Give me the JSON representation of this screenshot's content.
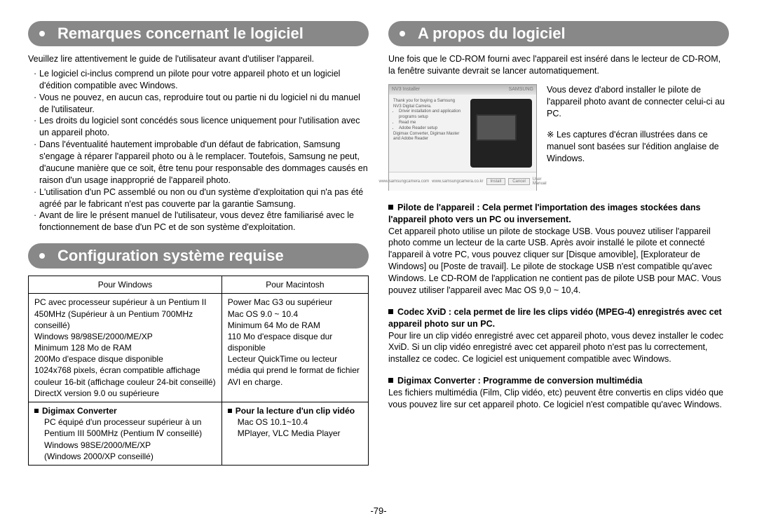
{
  "page_number": "-79-",
  "left": {
    "heading1": "Remarques concernant le logiciel",
    "intro": "Veuillez lire attentivement le guide de l'utilisateur avant d'utiliser l'appareil.",
    "bullets": [
      "Le logiciel ci-inclus comprend un pilote pour votre appareil photo et un logiciel d'édition compatible avec Windows.",
      "Vous ne pouvez, en aucun cas, reproduire tout ou partie ni du logiciel ni du manuel de l'utilisateur.",
      "Les droits du logiciel sont concédés sous licence uniquement pour l'utilisation avec un appareil photo.",
      "Dans l'éventualité hautement improbable d'un défaut de fabrication, Samsung s'engage à réparer l'appareil photo ou à le remplacer. Toutefois, Samsung ne peut, d'aucune manière que ce soit, être tenu pour responsable des dommages causés en raison d'un usage inapproprié de l'appareil photo.",
      "L'utilisation d'un PC assemblé ou non ou d'un système d'exploitation qui n'a pas été agréé par le fabricant n'est pas couverte par la garantie Samsung.",
      "Avant de lire le présent manuel de l'utilisateur, vous devez être familiarisé avec le fonctionnement de base d'un PC et de son système d'exploitation."
    ],
    "heading2": "Configuration système requise",
    "table": {
      "win_header": "Pour Windows",
      "mac_header": "Pour Macintosh",
      "win_body": [
        "PC avec processeur supérieur à un Pentium II 450MHz (Supérieur à un Pentium 700MHz conseillé)",
        "Windows 98/98SE/2000/ME/XP",
        "Minimum 128 Mo de RAM",
        "200Mo d'espace disque disponible",
        "1024x768 pixels, écran compatible affichage couleur 16-bit (affichage couleur 24-bit conseillé)",
        "DirectX version 9.0 ou supérieure"
      ],
      "mac_body": [
        "Power Mac G3 ou supérieur",
        "Mac OS 9.0 ~ 10.4",
        "Minimum 64 Mo de RAM",
        "110 Mo d'espace disque dur disponible",
        "Lecteur QuickTime ou lecteur média qui prend le format de fichier AVI en charge."
      ],
      "win_sub_title": "Digimax Converter",
      "win_sub_body": [
        "PC équipé d'un processeur supérieur à un Pentium III 500MHz (Pentium Ⅳ conseillé)",
        "Windows 98SE/2000/ME/XP",
        "(Windows 2000/XP conseillé)"
      ],
      "mac_sub_title": "Pour la lecture d'un clip vidéo",
      "mac_sub_body": [
        "Mac OS 10.1~10.4",
        "MPlayer, VLC Media Player"
      ]
    }
  },
  "right": {
    "heading": "A propos du logiciel",
    "intro": "Une fois que le CD-ROM fourni avec l'appareil est inséré dans le lecteur de CD-ROM, la fenêtre suivante devrait se lancer automatiquement.",
    "screenshot": {
      "installer_title": "NV3 Installer",
      "brand": "SAMSUNG",
      "install_btn": "Install",
      "cancel_btn": "Cancel",
      "link1": "www.samsungcamera.com",
      "link2": "www.samsungcamera.co.kr",
      "link3": "User Manual"
    },
    "side_text": "Vous devez d'abord installer le pilote de l'appareil photo avant de connecter celui-ci au PC.",
    "side_note": "Les captures d'écran illustrées dans ce manuel sont basées sur l'édition anglaise de Windows.",
    "sections": [
      {
        "title": "Pilote de l'appareil : Cela permet l'importation des images stockées dans l'appareil photo vers un PC ou inversement.",
        "body": "Cet appareil photo utilise un pilote de stockage USB. Vous pouvez utiliser l'appareil photo comme un lecteur de la carte USB. Après avoir installé le pilote et connecté l'appareil à votre PC, vous pouvez cliquer sur [Disque amovible], [Explorateur de Windows] ou [Poste de travail]. Le pilote de stockage USB n'est compatible qu'avec Windows. Le CD-ROM de l'application ne contient pas de pilote USB pour MAC. Vous pouvez utiliser l'appareil avec Mac OS 9,0 ~ 10,4."
      },
      {
        "title": "Codec XviD : cela permet de lire les clips vidéo (MPEG-4) enregistrés avec cet appareil photo sur un PC.",
        "body": "Pour lire un clip vidéo enregistré avec cet appareil photo, vous devez installer le codec XviD. Si un clip vidéo enregistré avec cet appareil photo n'est pas lu correctement, installez ce codec. Ce logiciel est uniquement compatible avec Windows."
      },
      {
        "title": "Digimax Converter : Programme de conversion multimédia",
        "body": "Les fichiers multimédia (Film, Clip vidéo, etc) peuvent être convertis en clips vidéo que vous pouvez lire sur cet appareil photo.  Ce logiciel n'est compatible qu'avec Windows."
      }
    ]
  }
}
